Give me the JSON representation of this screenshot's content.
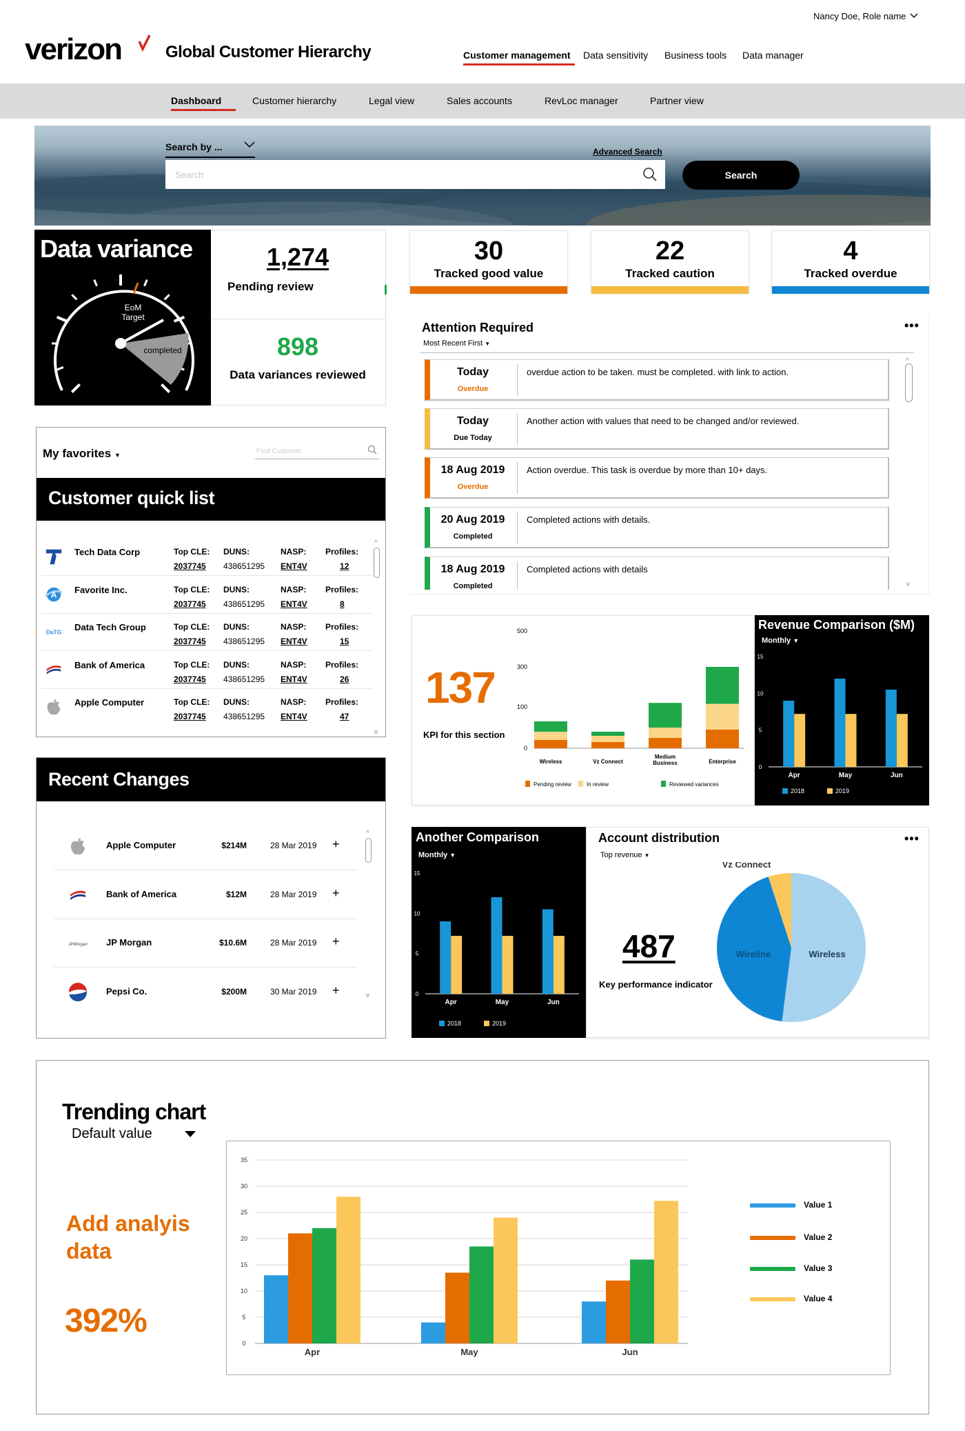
{
  "header": {
    "user_menu": "Nancy Doe, Role name",
    "brand": "verizon",
    "app_title": "Global Customer Hierarchy",
    "top_nav": [
      "Customer management",
      "Data sensitivity",
      "Business tools",
      "Data manager"
    ],
    "sub_nav": [
      "Dashboard",
      "Customer hierarchy",
      "Legal view",
      "Sales accounts",
      "RevLoc manager",
      "Partner view"
    ],
    "accent_color": "#d52b1e"
  },
  "search": {
    "search_by": "Search by ...",
    "advanced": "Advanced Search",
    "placeholder": "Search",
    "button": "Search"
  },
  "data_variance": {
    "title": "Data variance",
    "gauge_target": "EoM\nTarget",
    "gauge_completed": "completed",
    "pending_number": "1,274",
    "pending_label": "Pending review",
    "reviewed_number": "898",
    "reviewed_label": "Data variances reviewed"
  },
  "tracked": [
    {
      "value": "30",
      "label": "Tracked good value",
      "color": "#e56d00"
    },
    {
      "value": "22",
      "label": "Tracked caution",
      "color": "#f5bb41"
    },
    {
      "value": "4",
      "label": "Tracked overdue",
      "color": "#0f86d3"
    }
  ],
  "attention": {
    "title": "Attention Required",
    "sort": "Most Recent First",
    "more": "•••",
    "items": [
      {
        "date": "Today",
        "status": "Overdue",
        "status_color": "#e56d00",
        "text": "overdue action to be taken. must be completed. with link to action."
      },
      {
        "date": "Today",
        "status": "Due Today",
        "status_color": "#000000",
        "text": "Another action with values that need to be changed and/or reviewed."
      },
      {
        "date": "18 Aug 2019",
        "status": "Overdue",
        "status_color": "#e56d00",
        "text": "Action overdue. This task is overdue by more than 10+ days."
      },
      {
        "date": "20 Aug 2019",
        "status": "Completed",
        "status_color": "#000000",
        "text": "Completed actions with details."
      },
      {
        "date": "18 Aug 2019",
        "status": "Completed",
        "status_color": "#000000",
        "text": "Completed actions with details"
      }
    ]
  },
  "favorites": {
    "title": "My favorites",
    "find_placeholder": "Find Customer",
    "list_title": "Customer quick list",
    "labels": {
      "cle": "Top CLE:",
      "duns": "DUNS:",
      "nasp": "NASP:",
      "profiles": "Profiles:"
    },
    "customers": [
      {
        "name": "Tech Data Corp",
        "cle": "2037745",
        "duns": "438651295",
        "nasp": "ENT4V",
        "profiles": "12",
        "logo": "tech-data-logo"
      },
      {
        "name": "Favorite Inc.",
        "cle": "2037745",
        "duns": "438651295",
        "nasp": "ENT4V",
        "profiles": "8",
        "logo": "favorite-logo"
      },
      {
        "name": "Data Tech Group",
        "cle": "2037745",
        "duns": "438651295",
        "nasp": "ENT4V",
        "profiles": "15",
        "logo": "data-tech-logo"
      },
      {
        "name": "Bank of America",
        "cle": "2037745",
        "duns": "438651295",
        "nasp": "ENT4V",
        "profiles": "26",
        "logo": "bank-of-america-logo"
      },
      {
        "name": "Apple Computer",
        "cle": "2037745",
        "duns": "438651295",
        "nasp": "ENT4V",
        "profiles": "47",
        "logo": "apple-logo"
      }
    ],
    "data_tech_logo_text": "DaTG"
  },
  "recent_changes": {
    "title": "Recent Changes",
    "rows": [
      {
        "name": "Apple Computer",
        "amount": "$214M",
        "date": "28 Mar 2019"
      },
      {
        "name": "Bank of America",
        "amount": "$12M",
        "date": "28 Mar 2019"
      },
      {
        "name": "JP Morgan",
        "amount": "$10.6M",
        "date": "28 Mar 2019"
      },
      {
        "name": "Pepsi Co.",
        "amount": "$200M",
        "date": "30 Mar 2019"
      }
    ],
    "jp_logo_text": "JPMorgan",
    "plus": "+"
  },
  "kpi": {
    "value": "137",
    "label": "KPI for this section"
  },
  "revenue": {
    "title": "Revenue Comparison ($M)",
    "period": "Monthly"
  },
  "another": {
    "title": "Another Comparison",
    "period": "Monthly"
  },
  "account_distribution": {
    "title": "Account distribution",
    "sort": "Top revenue",
    "more": "•••",
    "value": "487",
    "label": "Key performance indicator"
  },
  "trending": {
    "title": "Trending chart",
    "selector": "Default value",
    "analysis": "Add analyis data",
    "percent": "392%"
  },
  "chart_data": [
    {
      "type": "bar",
      "stacked": true,
      "categories": [
        "Wireless",
        "Vz Connect",
        "Medium Business",
        "Enterprise"
      ],
      "series": [
        {
          "name": "Pending review",
          "color": "#e56d00",
          "values": [
            20,
            15,
            25,
            45
          ]
        },
        {
          "name": "In review",
          "color": "#fbd589",
          "values": [
            20,
            15,
            25,
            70
          ]
        },
        {
          "name": "Reviewed variances",
          "color": "#1fa84a",
          "values": [
            25,
            10,
            70,
            185
          ]
        }
      ],
      "y_ticks": [
        0,
        100,
        300,
        500
      ],
      "ylim": [
        0,
        500
      ]
    },
    {
      "type": "bar",
      "title": "Revenue Comparison ($M)",
      "categories": [
        "Apr",
        "May",
        "Jun"
      ],
      "series": [
        {
          "name": "2018",
          "color": "#1996d8",
          "values": [
            9,
            12,
            10.5
          ]
        },
        {
          "name": "2019",
          "color": "#fbc75b",
          "values": [
            7.2,
            7.2,
            7.2
          ]
        }
      ],
      "ylim": [
        0,
        15
      ],
      "y_ticks": [
        0,
        5,
        10,
        15
      ]
    },
    {
      "type": "bar",
      "title": "Another Comparison",
      "categories": [
        "Apr",
        "May",
        "Jun"
      ],
      "series": [
        {
          "name": "2018",
          "color": "#1996d8",
          "values": [
            9,
            12,
            10.5
          ]
        },
        {
          "name": "2019",
          "color": "#fbc75b",
          "values": [
            7.2,
            7.2,
            7.2
          ]
        }
      ],
      "ylim": [
        0,
        15
      ],
      "y_ticks": [
        0,
        5,
        10,
        15
      ]
    },
    {
      "type": "pie",
      "title": "Account distribution",
      "slices": [
        {
          "label": "Wireless",
          "value": 52,
          "color": "#a8d3ee"
        },
        {
          "label": "Wireline",
          "value": 43,
          "color": "#0f86d3"
        },
        {
          "label": "Vz Connect",
          "value": 5,
          "color": "#fbc75b"
        }
      ]
    },
    {
      "type": "bar",
      "title": "Trending chart",
      "categories": [
        "Apr",
        "May",
        "Jun"
      ],
      "series": [
        {
          "name": "Value 1",
          "color": "#2d9be0",
          "values": [
            13,
            4,
            8
          ]
        },
        {
          "name": "Value 2",
          "color": "#e56d00",
          "values": [
            21,
            13.5,
            12
          ]
        },
        {
          "name": "Value 3",
          "color": "#1fa84a",
          "values": [
            22,
            18.5,
            16
          ]
        },
        {
          "name": "Value 4",
          "color": "#fbc75b",
          "values": [
            28,
            24,
            27.2
          ]
        }
      ],
      "ylim": [
        0,
        35
      ],
      "y_ticks": [
        0,
        5,
        10,
        15,
        20,
        25,
        30,
        35
      ],
      "legend": "right"
    }
  ]
}
